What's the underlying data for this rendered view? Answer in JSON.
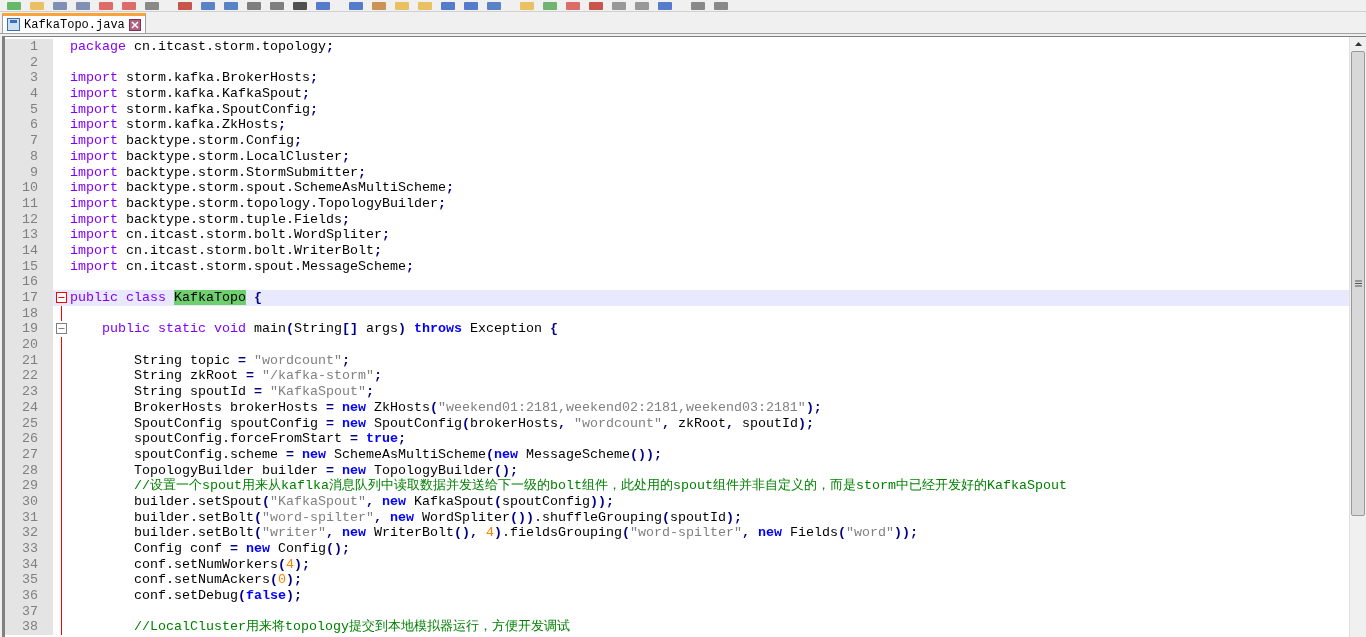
{
  "tabs": [
    {
      "title": "KafkaTopo.java",
      "selected": true
    }
  ],
  "lines": [
    {
      "n": "1",
      "current": false,
      "tokens": [
        {
          "kind": "kw",
          "text": "package"
        },
        {
          "kind": "tx",
          "text": " cn.itcast.storm.topology"
        },
        {
          "kind": "op",
          "text": ";"
        }
      ]
    },
    {
      "n": "2",
      "current": false
    },
    {
      "n": "3",
      "current": false,
      "tokens": [
        {
          "kind": "kw",
          "text": "import"
        },
        {
          "kind": "tx",
          "text": " storm.kafka.BrokerHosts"
        },
        {
          "kind": "op",
          "text": ";"
        }
      ]
    },
    {
      "n": "4",
      "current": false,
      "tokens": [
        {
          "kind": "kw",
          "text": "import"
        },
        {
          "kind": "tx",
          "text": " storm.kafka.KafkaSpout"
        },
        {
          "kind": "op",
          "text": ";"
        }
      ]
    },
    {
      "n": "5",
      "current": false,
      "tokens": [
        {
          "kind": "kw",
          "text": "import"
        },
        {
          "kind": "tx",
          "text": " storm.kafka.SpoutConfig"
        },
        {
          "kind": "op",
          "text": ";"
        }
      ]
    },
    {
      "n": "6",
      "current": false,
      "tokens": [
        {
          "kind": "kw",
          "text": "import"
        },
        {
          "kind": "tx",
          "text": " storm.kafka.ZkHosts"
        },
        {
          "kind": "op",
          "text": ";"
        }
      ]
    },
    {
      "n": "7",
      "current": false,
      "tokens": [
        {
          "kind": "kw",
          "text": "import"
        },
        {
          "kind": "tx",
          "text": " backtype.storm.Config"
        },
        {
          "kind": "op",
          "text": ";"
        }
      ]
    },
    {
      "n": "8",
      "current": false,
      "tokens": [
        {
          "kind": "kw",
          "text": "import"
        },
        {
          "kind": "tx",
          "text": " backtype.storm.LocalCluster"
        },
        {
          "kind": "op",
          "text": ";"
        }
      ]
    },
    {
      "n": "9",
      "current": false,
      "tokens": [
        {
          "kind": "kw",
          "text": "import"
        },
        {
          "kind": "tx",
          "text": " backtype.storm.StormSubmitter"
        },
        {
          "kind": "op",
          "text": ";"
        }
      ]
    },
    {
      "n": "10",
      "current": false,
      "tokens": [
        {
          "kind": "kw",
          "text": "import"
        },
        {
          "kind": "tx",
          "text": " backtype.storm.spout.SchemeAsMultiScheme"
        },
        {
          "kind": "op",
          "text": ";"
        }
      ]
    },
    {
      "n": "11",
      "current": false,
      "tokens": [
        {
          "kind": "kw",
          "text": "import"
        },
        {
          "kind": "tx",
          "text": " backtype.storm.topology.TopologyBuilder"
        },
        {
          "kind": "op",
          "text": ";"
        }
      ]
    },
    {
      "n": "12",
      "current": false,
      "tokens": [
        {
          "kind": "kw",
          "text": "import"
        },
        {
          "kind": "tx",
          "text": " backtype.storm.tuple.Fields"
        },
        {
          "kind": "op",
          "text": ";"
        }
      ]
    },
    {
      "n": "13",
      "current": false,
      "tokens": [
        {
          "kind": "kw",
          "text": "import"
        },
        {
          "kind": "tx",
          "text": " cn.itcast.storm.bolt.WordSpliter"
        },
        {
          "kind": "op",
          "text": ";"
        }
      ]
    },
    {
      "n": "14",
      "current": false,
      "tokens": [
        {
          "kind": "kw",
          "text": "import"
        },
        {
          "kind": "tx",
          "text": " cn.itcast.storm.bolt.WriterBolt"
        },
        {
          "kind": "op",
          "text": ";"
        }
      ]
    },
    {
      "n": "15",
      "current": false,
      "tokens": [
        {
          "kind": "kw",
          "text": "import"
        },
        {
          "kind": "tx",
          "text": " cn.itcast.storm.spout.MessageScheme"
        },
        {
          "kind": "op",
          "text": ";"
        }
      ]
    },
    {
      "n": "16",
      "current": false
    },
    {
      "n": "17",
      "current": true,
      "fold": {
        "expanded": true
      },
      "tokens": [
        {
          "kind": "kw",
          "text": "public class "
        },
        {
          "kind": "hl",
          "text": "KafkaTopo"
        },
        {
          "kind": "op",
          "text": " {"
        }
      ]
    },
    {
      "n": "18",
      "current": false
    },
    {
      "n": "19",
      "current": false,
      "fold": {
        "expanded": true
      },
      "tokens": [
        {
          "kind": "kw",
          "text": "    public static void"
        },
        {
          "kind": "tx",
          "text": " main"
        },
        {
          "kind": "op",
          "text": "("
        },
        {
          "kind": "tx",
          "text": "String"
        },
        {
          "kind": "op",
          "text": "[]"
        },
        {
          "kind": "tx",
          "text": " args"
        },
        {
          "kind": "op",
          "text": ")"
        },
        {
          "kind": "kw2",
          "text": " throws"
        },
        {
          "kind": "tx",
          "text": " Exception"
        },
        {
          "kind": "op",
          "text": " {"
        }
      ]
    },
    {
      "n": "20",
      "current": false
    },
    {
      "n": "21",
      "current": false,
      "tokens": [
        {
          "kind": "tx",
          "text": "        String topic"
        },
        {
          "kind": "op",
          "text": " ="
        },
        {
          "kind": "str",
          "text": " \"wordcount\""
        },
        {
          "kind": "op",
          "text": ";"
        }
      ]
    },
    {
      "n": "22",
      "current": false,
      "tokens": [
        {
          "kind": "tx",
          "text": "        String zkRoot"
        },
        {
          "kind": "op",
          "text": " ="
        },
        {
          "kind": "str",
          "text": " \"/kafka-storm\""
        },
        {
          "kind": "op",
          "text": ";"
        }
      ]
    },
    {
      "n": "23",
      "current": false,
      "tokens": [
        {
          "kind": "tx",
          "text": "        String spoutId"
        },
        {
          "kind": "op",
          "text": " ="
        },
        {
          "kind": "str",
          "text": " \"KafkaSpout\""
        },
        {
          "kind": "op",
          "text": ";"
        }
      ]
    },
    {
      "n": "24",
      "current": false,
      "tokens": [
        {
          "kind": "tx",
          "text": "        BrokerHosts brokerHosts"
        },
        {
          "kind": "op",
          "text": " ="
        },
        {
          "kind": "kw2",
          "text": " new"
        },
        {
          "kind": "tx",
          "text": " ZkHosts"
        },
        {
          "kind": "op",
          "text": "("
        },
        {
          "kind": "str",
          "text": "\"weekend01:2181,weekend02:2181,weekend03:2181\""
        },
        {
          "kind": "op",
          "text": ");"
        }
      ]
    },
    {
      "n": "25",
      "current": false,
      "tokens": [
        {
          "kind": "tx",
          "text": "        SpoutConfig spoutConfig"
        },
        {
          "kind": "op",
          "text": " ="
        },
        {
          "kind": "kw2",
          "text": " new"
        },
        {
          "kind": "tx",
          "text": " SpoutConfig"
        },
        {
          "kind": "op",
          "text": "("
        },
        {
          "kind": "tx",
          "text": "brokerHosts"
        },
        {
          "kind": "op",
          "text": ","
        },
        {
          "kind": "str",
          "text": " \"wordcount\""
        },
        {
          "kind": "op",
          "text": ","
        },
        {
          "kind": "tx",
          "text": " zkRoot"
        },
        {
          "kind": "op",
          "text": ","
        },
        {
          "kind": "tx",
          "text": " spoutId"
        },
        {
          "kind": "op",
          "text": ");"
        }
      ]
    },
    {
      "n": "26",
      "current": false,
      "tokens": [
        {
          "kind": "tx",
          "text": "        spoutConfig.forceFromStart"
        },
        {
          "kind": "op",
          "text": " ="
        },
        {
          "kind": "kw2",
          "text": " true"
        },
        {
          "kind": "op",
          "text": ";"
        }
      ]
    },
    {
      "n": "27",
      "current": false,
      "tokens": [
        {
          "kind": "tx",
          "text": "        spoutConfig.scheme"
        },
        {
          "kind": "op",
          "text": " ="
        },
        {
          "kind": "kw2",
          "text": " new"
        },
        {
          "kind": "tx",
          "text": " SchemeAsMultiScheme"
        },
        {
          "kind": "op",
          "text": "("
        },
        {
          "kind": "kw2",
          "text": "new"
        },
        {
          "kind": "tx",
          "text": " MessageScheme"
        },
        {
          "kind": "op",
          "text": "());"
        }
      ]
    },
    {
      "n": "28",
      "current": false,
      "tokens": [
        {
          "kind": "tx",
          "text": "        TopologyBuilder builder"
        },
        {
          "kind": "op",
          "text": " ="
        },
        {
          "kind": "kw2",
          "text": " new"
        },
        {
          "kind": "tx",
          "text": " TopologyBuilder"
        },
        {
          "kind": "op",
          "text": "();"
        }
      ]
    },
    {
      "n": "29",
      "current": false,
      "tokens": [
        {
          "kind": "cm",
          "text": "        //设置一个spout用来从kaflka消息队列中读取数据并发送给下一级的bolt组件，此处用的spout组件并非自定义的，而是storm中已经开发好的KafkaSpout"
        }
      ]
    },
    {
      "n": "30",
      "current": false,
      "tokens": [
        {
          "kind": "tx",
          "text": "        builder.setSpout"
        },
        {
          "kind": "op",
          "text": "("
        },
        {
          "kind": "str",
          "text": "\"KafkaSpout\""
        },
        {
          "kind": "op",
          "text": ","
        },
        {
          "kind": "kw2",
          "text": " new"
        },
        {
          "kind": "tx",
          "text": " KafkaSpout"
        },
        {
          "kind": "op",
          "text": "("
        },
        {
          "kind": "tx",
          "text": "spoutConfig"
        },
        {
          "kind": "op",
          "text": "));"
        }
      ]
    },
    {
      "n": "31",
      "current": false,
      "tokens": [
        {
          "kind": "tx",
          "text": "        builder.setBolt"
        },
        {
          "kind": "op",
          "text": "("
        },
        {
          "kind": "str",
          "text": "\"word-spilter\""
        },
        {
          "kind": "op",
          "text": ","
        },
        {
          "kind": "kw2",
          "text": " new"
        },
        {
          "kind": "tx",
          "text": " WordSpliter"
        },
        {
          "kind": "op",
          "text": "())"
        },
        {
          "kind": "tx",
          "text": ".shuffleGrouping"
        },
        {
          "kind": "op",
          "text": "("
        },
        {
          "kind": "tx",
          "text": "spoutId"
        },
        {
          "kind": "op",
          "text": ");"
        }
      ]
    },
    {
      "n": "32",
      "current": false,
      "tokens": [
        {
          "kind": "tx",
          "text": "        builder.setBolt"
        },
        {
          "kind": "op",
          "text": "("
        },
        {
          "kind": "str",
          "text": "\"writer\""
        },
        {
          "kind": "op",
          "text": ","
        },
        {
          "kind": "kw2",
          "text": " new"
        },
        {
          "kind": "tx",
          "text": " WriterBolt"
        },
        {
          "kind": "op",
          "text": "(),"
        },
        {
          "kind": "num",
          "text": " 4"
        },
        {
          "kind": "op",
          "text": ")"
        },
        {
          "kind": "tx",
          "text": ".fieldsGrouping"
        },
        {
          "kind": "op",
          "text": "("
        },
        {
          "kind": "str",
          "text": "\"word-spilter\""
        },
        {
          "kind": "op",
          "text": ","
        },
        {
          "kind": "kw2",
          "text": " new"
        },
        {
          "kind": "tx",
          "text": " Fields"
        },
        {
          "kind": "op",
          "text": "("
        },
        {
          "kind": "str",
          "text": "\"word\""
        },
        {
          "kind": "op",
          "text": "));"
        }
      ]
    },
    {
      "n": "33",
      "current": false,
      "tokens": [
        {
          "kind": "tx",
          "text": "        Config conf"
        },
        {
          "kind": "op",
          "text": " ="
        },
        {
          "kind": "kw2",
          "text": " new"
        },
        {
          "kind": "tx",
          "text": " Config"
        },
        {
          "kind": "op",
          "text": "();"
        }
      ]
    },
    {
      "n": "34",
      "current": false,
      "tokens": [
        {
          "kind": "tx",
          "text": "        conf.setNumWorkers"
        },
        {
          "kind": "op",
          "text": "("
        },
        {
          "kind": "num",
          "text": "4"
        },
        {
          "kind": "op",
          "text": ");"
        }
      ]
    },
    {
      "n": "35",
      "current": false,
      "tokens": [
        {
          "kind": "tx",
          "text": "        conf.setNumAckers"
        },
        {
          "kind": "op",
          "text": "("
        },
        {
          "kind": "num",
          "text": "0"
        },
        {
          "kind": "op",
          "text": ");"
        }
      ]
    },
    {
      "n": "36",
      "current": false,
      "tokens": [
        {
          "kind": "tx",
          "text": "        conf.setDebug"
        },
        {
          "kind": "op",
          "text": "("
        },
        {
          "kind": "kw2",
          "text": "false"
        },
        {
          "kind": "op",
          "text": ");"
        }
      ]
    },
    {
      "n": "37",
      "current": false
    },
    {
      "n": "38",
      "current": false,
      "tokens": [
        {
          "kind": "cm",
          "text": "        //LocalCluster用来将topology提交到本地模拟器运行，方便开发调试"
        }
      ]
    }
  ]
}
